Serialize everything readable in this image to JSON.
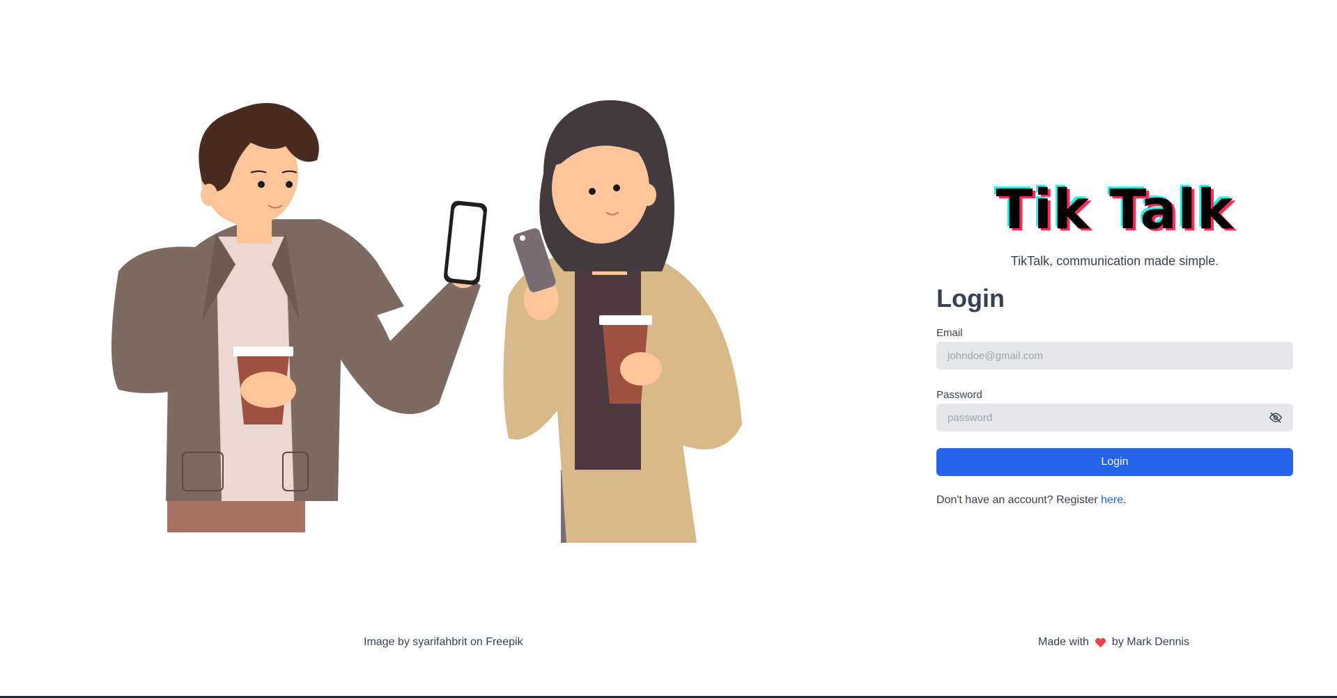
{
  "logo": {
    "text": "Tik Talk"
  },
  "tagline": "TikTalk, communication made simple.",
  "login": {
    "title": "Login",
    "email_label": "Email",
    "email_placeholder": "johndoe@gmail.com",
    "email_value": "",
    "password_label": "Password",
    "password_placeholder": "password",
    "password_value": "",
    "password_toggle_icon": "eye-off-icon",
    "submit_label": "Login",
    "register_prompt": "Don't have an account? Register",
    "register_link": "here",
    "register_suffix": "."
  },
  "footer": {
    "image_credit": "Image by syarifahbrit on Freepik",
    "made_with_prefix": "Made with",
    "heart_icon": "heart-icon",
    "made_with_suffix": "by Mark Dennis"
  },
  "colors": {
    "primary": "#2563eb",
    "input_bg": "#e5e7eb",
    "text": "#374151",
    "logo_cyan": "#25f4ee",
    "logo_pink": "#fe2c55",
    "heart": "#ef4444"
  }
}
